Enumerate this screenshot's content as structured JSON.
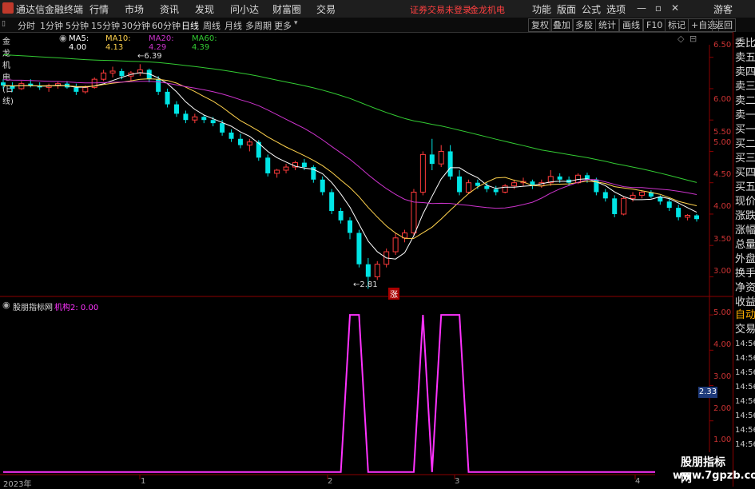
{
  "app": {
    "title": "通达信金融终端"
  },
  "menu": [
    "行情",
    "市场",
    "资讯",
    "发现",
    "问小达",
    "财富圈",
    "交易"
  ],
  "status_warning": "证券交易未登录",
  "stock_title_top": "金龙机电",
  "menu_right": [
    "功能",
    "版面",
    "公式",
    "选项"
  ],
  "guest": "游客",
  "periods": [
    "分时",
    "1分钟",
    "5分钟",
    "15分钟",
    "30分钟",
    "60分钟",
    "日线",
    "周线",
    "月线",
    "多周期",
    "更多"
  ],
  "active_period": "日线",
  "toolbar_right": [
    "复权",
    "叠加",
    "多股",
    "统计",
    "画线",
    "F10",
    "标记",
    "+自选",
    "返回"
  ],
  "info": {
    "stock": "金龙机电(日线)",
    "ma5": "MA5: 4.00",
    "ma10": "MA10: 4.13",
    "ma20": "MA20: 4.29",
    "ma60": "MA60: 4.39"
  },
  "annotations": {
    "high": "6.39",
    "low": "2.81",
    "zhang": "涨"
  },
  "y_axis_main": [
    "6.50",
    "6.00",
    "5.50",
    "5.00",
    "4.50",
    "4.00",
    "3.50",
    "3.00"
  ],
  "y_axis_sub": [
    "5.00",
    "4.00",
    "3.00",
    "2.00",
    "1.00"
  ],
  "indicator": {
    "name": "股朋指标网",
    "value": "机构2: 0.00"
  },
  "x_axis": [
    "2023年",
    "1",
    "2",
    "3",
    "4"
  ],
  "right_panel": [
    "委比",
    "卖五",
    "卖四",
    "卖三",
    "卖二",
    "卖一",
    "买一",
    "买二",
    "买三",
    "买四",
    "买五",
    "现价",
    "涨跌",
    "涨幅",
    "总量",
    "外盘",
    "换手",
    "净资",
    "收益"
  ],
  "right_panel_bottom": {
    "auto": "自动",
    "trade": "交易",
    "times": [
      "14:56",
      "14:56",
      "14:56",
      "14:56",
      "14:56",
      "14:56",
      "14:56",
      "14:56"
    ]
  },
  "price_badge": "2.33",
  "watermark": {
    "line1": "股朋指标网",
    "line2": "www.7gpzb.com"
  },
  "chart_data": [
    {
      "type": "candlestick",
      "title": "金龙机电(日线)",
      "ylim": [
        2.7,
        6.7
      ],
      "x": [
        "2023年",
        "1",
        "2",
        "3",
        "4"
      ],
      "candles": [
        [
          6.1,
          6.15,
          6.0,
          6.05
        ],
        [
          6.05,
          6.1,
          5.95,
          6.0
        ],
        [
          6.0,
          6.12,
          5.98,
          6.08
        ],
        [
          6.08,
          6.15,
          6.02,
          6.05
        ],
        [
          6.05,
          6.1,
          5.98,
          6.02
        ],
        [
          6.02,
          6.08,
          5.95,
          6.05
        ],
        [
          6.05,
          6.12,
          6.0,
          6.08
        ],
        [
          6.08,
          6.12,
          6.0,
          6.02
        ],
        [
          6.02,
          6.08,
          5.9,
          5.95
        ],
        [
          5.95,
          6.05,
          5.92,
          6.02
        ],
        [
          6.02,
          6.18,
          6.0,
          6.15
        ],
        [
          6.15,
          6.3,
          6.12,
          6.25
        ],
        [
          6.25,
          6.35,
          6.18,
          6.28
        ],
        [
          6.28,
          6.32,
          6.15,
          6.2
        ],
        [
          6.2,
          6.28,
          6.12,
          6.25
        ],
        [
          6.25,
          6.39,
          6.2,
          6.3
        ],
        [
          6.3,
          6.32,
          6.1,
          6.15
        ],
        [
          6.15,
          6.2,
          5.9,
          5.95
        ],
        [
          5.95,
          6.0,
          5.7,
          5.75
        ],
        [
          5.75,
          5.8,
          5.55,
          5.6
        ],
        [
          5.6,
          5.65,
          5.45,
          5.5
        ],
        [
          5.5,
          5.6,
          5.45,
          5.55
        ],
        [
          5.55,
          5.58,
          5.45,
          5.5
        ],
        [
          5.5,
          5.55,
          5.4,
          5.45
        ],
        [
          5.45,
          5.5,
          5.25,
          5.3
        ],
        [
          5.3,
          5.35,
          5.15,
          5.2
        ],
        [
          5.2,
          5.28,
          5.05,
          5.1
        ],
        [
          5.1,
          5.2,
          5.0,
          5.15
        ],
        [
          5.15,
          5.18,
          4.85,
          4.9
        ],
        [
          4.9,
          4.95,
          4.6,
          4.65
        ],
        [
          4.65,
          4.72,
          4.58,
          4.7
        ],
        [
          4.7,
          4.8,
          4.65,
          4.75
        ],
        [
          4.75,
          4.85,
          4.7,
          4.82
        ],
        [
          4.82,
          4.88,
          4.7,
          4.75
        ],
        [
          4.75,
          4.78,
          4.5,
          4.55
        ],
        [
          4.55,
          4.6,
          4.3,
          4.35
        ],
        [
          4.35,
          4.4,
          4.0,
          4.05
        ],
        [
          4.05,
          4.1,
          3.85,
          3.9
        ],
        [
          3.9,
          3.95,
          3.6,
          3.7
        ],
        [
          3.7,
          3.75,
          3.15,
          3.2
        ],
        [
          3.2,
          3.3,
          2.81,
          3.0
        ],
        [
          3.0,
          3.25,
          2.95,
          3.2
        ],
        [
          3.2,
          3.45,
          3.15,
          3.4
        ],
        [
          3.4,
          3.7,
          3.35,
          3.62
        ],
        [
          3.62,
          3.75,
          3.55,
          3.7
        ],
        [
          3.7,
          4.4,
          3.65,
          4.35
        ],
        [
          4.35,
          5.0,
          4.3,
          4.95
        ],
        [
          4.95,
          5.2,
          4.7,
          4.8
        ],
        [
          4.8,
          5.1,
          4.75,
          5.0
        ],
        [
          5.0,
          5.1,
          4.55,
          4.6
        ],
        [
          4.6,
          4.7,
          4.3,
          4.35
        ],
        [
          4.35,
          4.55,
          4.32,
          4.5
        ],
        [
          4.5,
          4.55,
          4.4,
          4.45
        ],
        [
          4.45,
          4.5,
          4.35,
          4.4
        ],
        [
          4.4,
          4.45,
          4.3,
          4.35
        ],
        [
          4.35,
          4.48,
          4.33,
          4.45
        ],
        [
          4.45,
          4.55,
          4.4,
          4.5
        ],
        [
          4.5,
          4.58,
          4.45,
          4.52
        ],
        [
          4.52,
          4.55,
          4.4,
          4.45
        ],
        [
          4.45,
          4.55,
          4.42,
          4.5
        ],
        [
          4.5,
          4.7,
          4.45,
          4.6
        ],
        [
          4.6,
          4.65,
          4.5,
          4.55
        ],
        [
          4.55,
          4.6,
          4.45,
          4.5
        ],
        [
          4.5,
          4.65,
          4.48,
          4.62
        ],
        [
          4.62,
          4.66,
          4.5,
          4.55
        ],
        [
          4.55,
          4.58,
          4.3,
          4.35
        ],
        [
          4.35,
          4.4,
          4.2,
          4.25
        ],
        [
          4.25,
          4.3,
          3.95,
          4.0
        ],
        [
          4.0,
          4.28,
          3.98,
          4.25
        ],
        [
          4.25,
          4.35,
          4.2,
          4.3
        ],
        [
          4.3,
          4.38,
          4.25,
          4.35
        ],
        [
          4.35,
          4.38,
          4.25,
          4.28
        ],
        [
          4.28,
          4.3,
          4.15,
          4.2
        ],
        [
          4.2,
          4.25,
          4.05,
          4.1
        ],
        [
          4.1,
          4.15,
          3.9,
          3.95
        ],
        [
          3.95,
          4.0,
          3.9,
          3.98
        ],
        [
          3.98,
          4.0,
          3.88,
          3.92
        ]
      ],
      "series": [
        {
          "name": "MA5",
          "color": "#ffffff"
        },
        {
          "name": "MA10",
          "color": "#ffd24d"
        },
        {
          "name": "MA20",
          "color": "#cc33cc"
        },
        {
          "name": "MA60",
          "color": "#33cc33"
        }
      ]
    },
    {
      "type": "line",
      "title": "机构2",
      "ylim": [
        0.5,
        5.5
      ],
      "values": [
        0,
        0,
        0,
        0,
        0,
        0,
        0,
        0,
        0,
        0,
        0,
        0,
        0,
        0,
        0,
        0,
        0,
        0,
        0,
        0,
        0,
        0,
        0,
        0,
        0,
        0,
        0,
        0,
        0,
        0,
        0,
        0,
        0,
        0,
        0,
        0,
        0,
        0,
        5,
        5,
        0,
        0,
        0,
        0,
        0,
        0,
        5,
        0,
        5,
        5,
        5,
        0,
        0,
        0,
        0,
        0,
        0,
        0,
        0,
        0,
        0,
        0,
        0,
        0,
        0,
        0,
        0,
        0,
        0,
        0,
        0,
        0,
        0,
        0,
        0,
        0,
        0
      ],
      "color": "#ff33ff"
    }
  ]
}
